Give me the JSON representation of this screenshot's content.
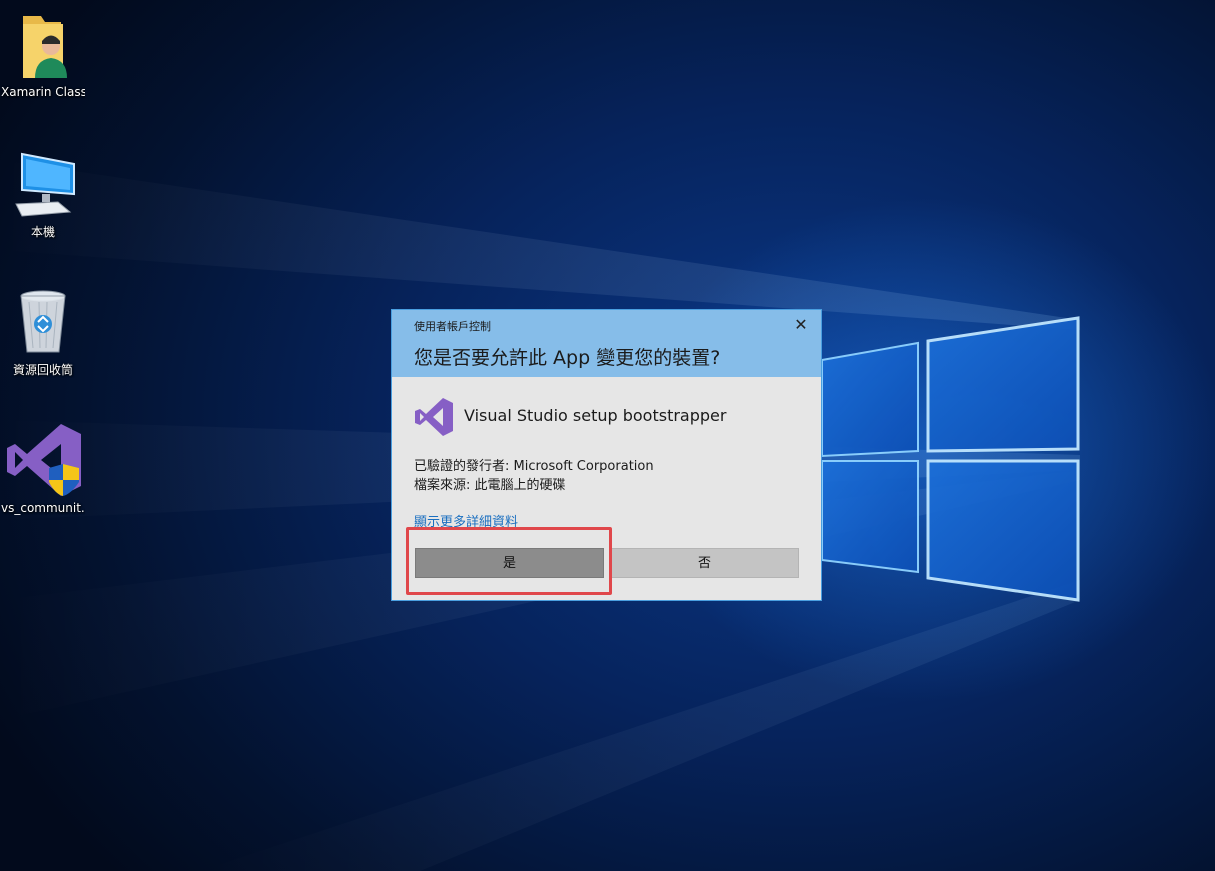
{
  "desktop": {
    "icons": [
      {
        "label": "Xamarin Class",
        "icon": "user-folder-icon"
      },
      {
        "label": "本機",
        "icon": "computer-icon"
      },
      {
        "label": "資源回收筒",
        "icon": "recycle-bin-icon"
      },
      {
        "label": "vs_communit...",
        "icon": "visual-studio-installer-icon"
      }
    ]
  },
  "uac": {
    "caption": "使用者帳戶控制",
    "question": "您是否要允許此 App 變更您的裝置?",
    "app_name": "Visual Studio setup bootstrapper",
    "publisher": "已驗證的發行者: Microsoft Corporation",
    "origin": "檔案來源: 此電腦上的硬碟",
    "details_link": "顯示更多詳細資料",
    "yes_label": "是",
    "no_label": "否",
    "close_glyph": "✕"
  },
  "colors": {
    "uac_header": "#86bde9",
    "uac_body": "#e6e6e6",
    "vs_purple": "#865fc5",
    "highlight": "#e0474b"
  }
}
